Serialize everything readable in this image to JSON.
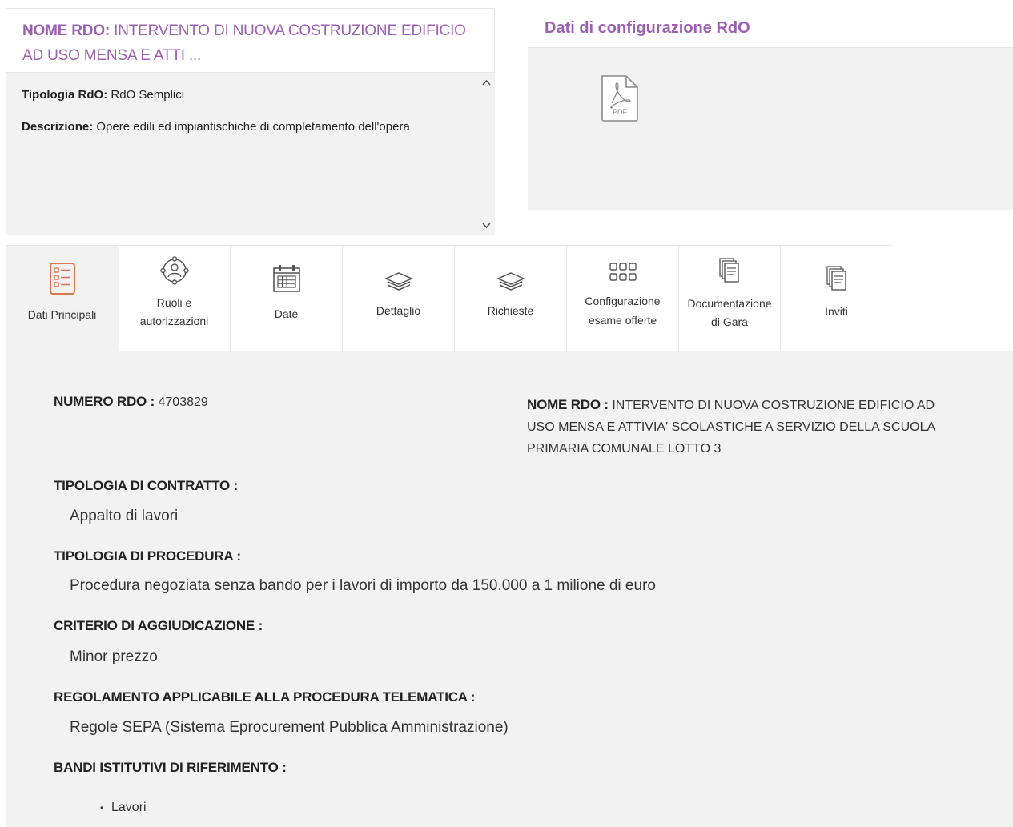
{
  "rdo_card": {
    "title_label": "NOME RDO:",
    "title_value": "INTERVENTO DI NUOVA COSTRUZIONE EDIFICIO AD USO MENSA E ATTI ...",
    "tipologia_label": "Tipologia RdO:",
    "tipologia_value": "RdO Semplici",
    "descrizione_label": "Descrizione:",
    "descrizione_value": "Opere edili ed impiantischiche di completamento dell'opera",
    "scroll_up": "⌃",
    "scroll_down": "⌄"
  },
  "config_card": {
    "title": "Dati di configurazione RdO",
    "pdf_label": "PDF"
  },
  "tabs": [
    {
      "label": "Dati Principali",
      "icon": "list-icon",
      "active": true
    },
    {
      "label_1": "Ruoli e",
      "label_2": "autorizzazioni",
      "icon": "roles-icon"
    },
    {
      "label": "Date",
      "icon": "calendar-icon"
    },
    {
      "label": "Dettaglio",
      "icon": "layers-icon"
    },
    {
      "label": "Richieste",
      "icon": "layers-icon"
    },
    {
      "label_1": "Configurazione",
      "label_2": "esame offerte",
      "icon": "grid-icon"
    },
    {
      "label_1": "Documentazione",
      "label_2": "di Gara",
      "icon": "documents-icon"
    },
    {
      "label": "Inviti",
      "icon": "documents-icon"
    }
  ],
  "main": {
    "numero_label": "NUMERO RDO :",
    "numero_value": "4703829",
    "nome_label": "NOME RDO :",
    "nome_line1": "INTERVENTO DI NUOVA COSTRUZIONE EDIFICIO AD",
    "nome_line2": "USO MENSA E ATTIVIA' SCOLASTICHE A SERVIZIO DELLA SCUOLA",
    "nome_line3": "PRIMARIA COMUNALE LOTTO 3",
    "contratto_label": "TIPOLOGIA DI CONTRATTO :",
    "contratto_value": "Appalto di lavori",
    "procedura_label": "TIPOLOGIA DI PROCEDURA :",
    "procedura_value": "Procedura negoziata senza bando per i lavori di importo da 150.000 a 1 milione di euro",
    "criterio_label": "CRITERIO DI AGGIUDICAZIONE :",
    "criterio_value": "Minor prezzo",
    "regolamento_label": "REGOLAMENTO APPLICABILE ALLA PROCEDURA TELEMATICA :",
    "regolamento_value": "Regole SEPA (Sistema Eprocurement Pubblica Amministrazione)",
    "bandi_label": "BANDI ISTITUTIVI DI RIFERIMENTO :",
    "bandi_items": [
      "Lavori"
    ]
  },
  "colors": {
    "accent_purple": "#9b5fb3",
    "active_icon_orange": "#e0754a",
    "panel_gray": "#f2f2f2"
  }
}
